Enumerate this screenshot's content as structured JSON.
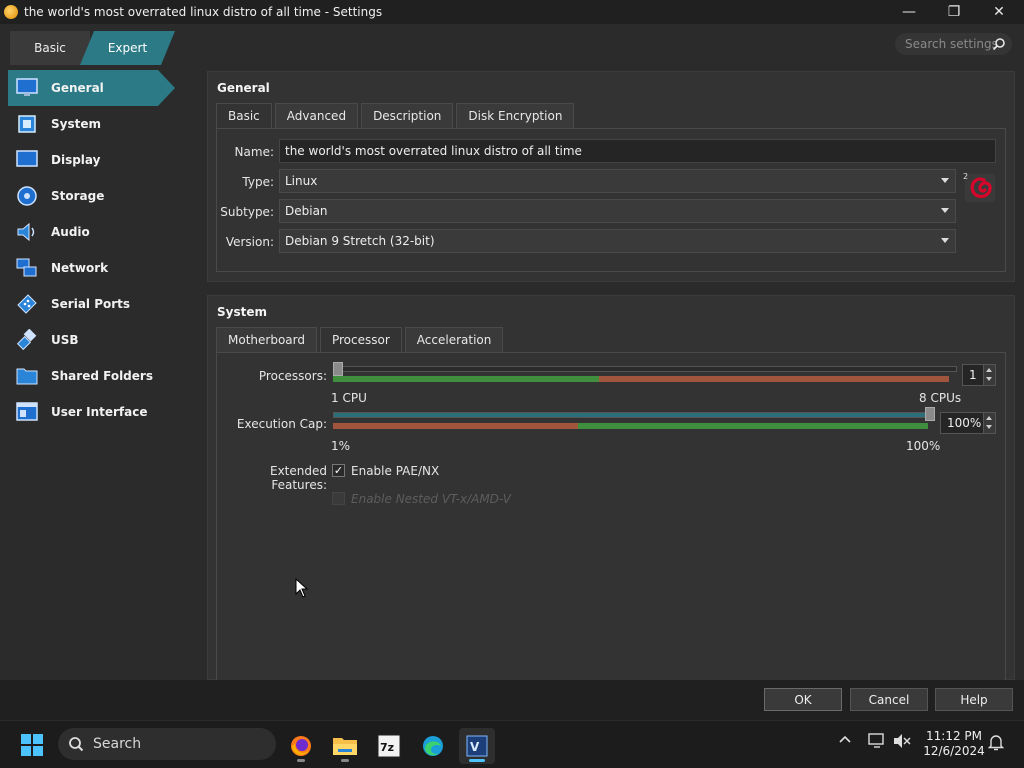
{
  "window": {
    "title": "the world's most overrated linux distro of all time - Settings",
    "minimize": "—",
    "maximize": "❐",
    "close": "✕"
  },
  "mode": {
    "basic": "Basic",
    "expert": "Expert",
    "selected": "Expert"
  },
  "search": {
    "placeholder": "Search settings"
  },
  "sidebar": {
    "items": [
      {
        "label": "General",
        "icon": "monitor-icon",
        "active": true
      },
      {
        "label": "System",
        "icon": "chip-icon"
      },
      {
        "label": "Display",
        "icon": "display-icon"
      },
      {
        "label": "Storage",
        "icon": "disk-icon"
      },
      {
        "label": "Audio",
        "icon": "speaker-icon"
      },
      {
        "label": "Network",
        "icon": "network-icon"
      },
      {
        "label": "Serial Ports",
        "icon": "serial-port-icon"
      },
      {
        "label": "USB",
        "icon": "usb-icon"
      },
      {
        "label": "Shared Folders",
        "icon": "folder-icon"
      },
      {
        "label": "User Interface",
        "icon": "window-icon"
      }
    ]
  },
  "general": {
    "title": "General",
    "tabs": [
      "Basic",
      "Advanced",
      "Description",
      "Disk Encryption"
    ],
    "active_tab": "Basic",
    "name_label": "Name:",
    "name_value": "the world's most overrated linux distro of all time",
    "type_label": "Type:",
    "type_value": "Linux",
    "subtype_label": "Subtype:",
    "subtype_value": "Debian",
    "version_label": "Version:",
    "version_value": "Debian 9 Stretch (32-bit)",
    "os_icon": "debian-swirl-icon"
  },
  "system": {
    "title": "System",
    "tabs": [
      "Motherboard",
      "Processor",
      "Acceleration"
    ],
    "active_tab": "Processor",
    "processors_label": "Processors:",
    "processors_value": "1",
    "processors_min": "1 CPU",
    "processors_max": "8 CPUs",
    "processors_fraction": 0.0,
    "exec_cap_label": "Execution Cap:",
    "exec_cap_value": "100%",
    "exec_cap_min": "1%",
    "exec_cap_max": "100%",
    "exec_cap_fraction": 1.0,
    "extended_label": "Extended Features:",
    "pae_label": "Enable PAE/NX",
    "pae_checked": true,
    "nested_label": "Enable Nested VT-x/AMD-V",
    "nested_enabled": false
  },
  "buttons": {
    "ok": "OK",
    "cancel": "Cancel",
    "help": "Help"
  },
  "taskbar": {
    "search_label": "Search",
    "apps": [
      "firefox-icon",
      "file-explorer-icon",
      "7zip-icon",
      "edge-icon",
      "virtualbox-icon"
    ],
    "time": "11:12 PM",
    "date": "12/6/2024"
  },
  "colors": {
    "accent": "#2b7a86",
    "slider_green": "#3f8f3f",
    "slider_red": "#a0553c"
  }
}
